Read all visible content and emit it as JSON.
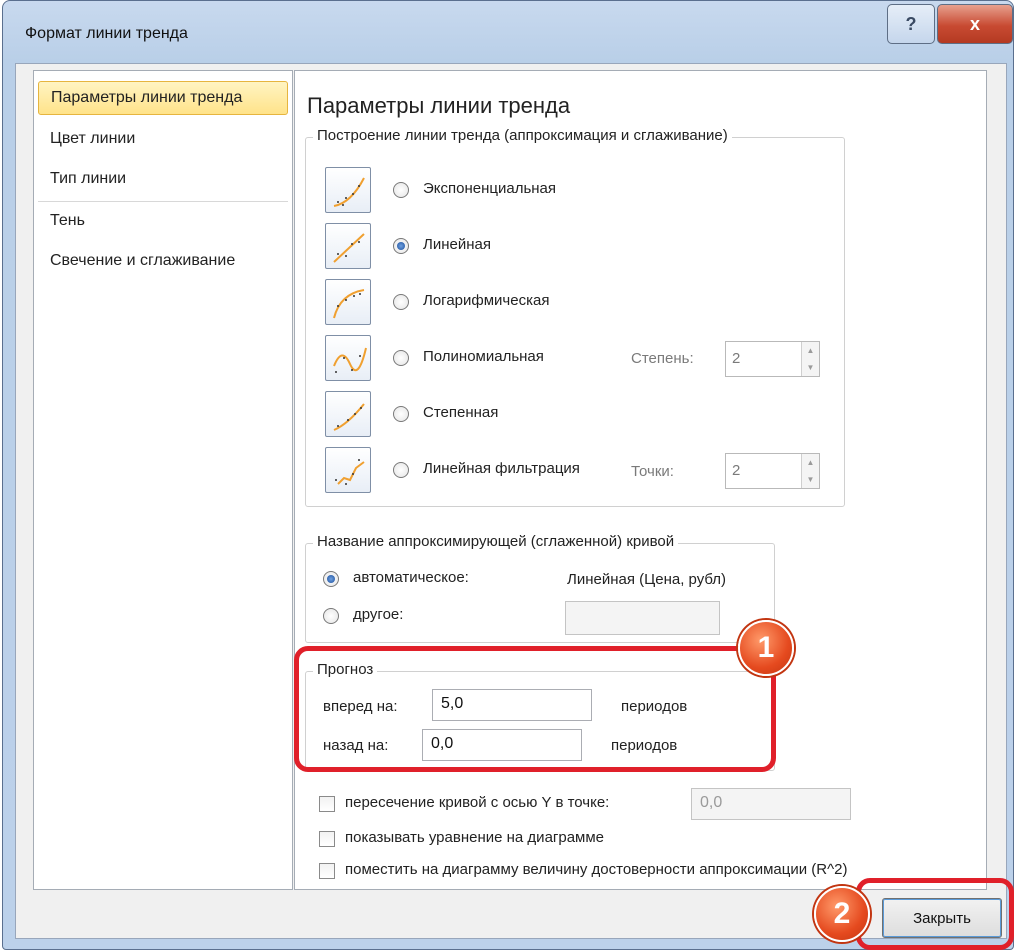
{
  "window": {
    "title": "Формат линии тренда",
    "help_glyph": "?",
    "close_glyph": "x"
  },
  "nav": {
    "items": [
      {
        "label": "Параметры линии тренда",
        "selected": true
      },
      {
        "label": "Цвет линии",
        "selected": false
      },
      {
        "label": "Тип линии",
        "selected": false
      },
      {
        "label": "Тень",
        "selected": false
      },
      {
        "label": "Свечение и сглаживание",
        "selected": false
      }
    ]
  },
  "panel": {
    "title": "Параметры линии тренда",
    "trend_group": {
      "label": "Построение линии тренда (аппроксимация и сглаживание)",
      "options": [
        {
          "label": "Экспоненциальная",
          "icon": "exponential-trend-icon",
          "checked": false
        },
        {
          "label": "Линейная",
          "icon": "linear-trend-icon",
          "checked": true
        },
        {
          "label": "Логарифмическая",
          "icon": "logarithmic-trend-icon",
          "checked": false
        },
        {
          "label": "Полиномиальная",
          "icon": "polynomial-trend-icon",
          "checked": false
        },
        {
          "label": "Степенная",
          "icon": "power-trend-icon",
          "checked": false
        },
        {
          "label": "Линейная фильтрация",
          "icon": "moving-average-trend-icon",
          "checked": false
        }
      ],
      "degree_label": "Степень:",
      "degree_value": "2",
      "points_label": "Точки:",
      "points_value": "2"
    },
    "name_group": {
      "label": "Название аппроксимирующей (сглаженной) кривой",
      "auto_label": "автоматическое:",
      "auto_value": "Линейная (Цена, рубл)",
      "auto_checked": true,
      "custom_label": "другое:",
      "custom_value": ""
    },
    "forecast_group": {
      "label": "Прогноз",
      "forward_label": "вперед на:",
      "forward_value": "5,0",
      "forward_unit": "периодов",
      "backward_label": "назад на:",
      "backward_value": "0,0",
      "backward_unit": "периодов"
    },
    "checks": {
      "intercept_label": "пересечение кривой с осью Y в точке:",
      "intercept_value": "0,0",
      "equation_label": "показывать уравнение на диаграмме",
      "r2_label": "поместить на диаграмму величину достоверности аппроксимации (R^2)"
    }
  },
  "annotations": {
    "badge1": "1",
    "badge2": "2"
  },
  "buttons": {
    "close_label": "Закрыть"
  },
  "colors": {
    "selection_bg": "#ffe38a",
    "annotation_red": "#e0202a",
    "badge_orange": "#e54a1f",
    "trend_line": "#f0a030"
  }
}
